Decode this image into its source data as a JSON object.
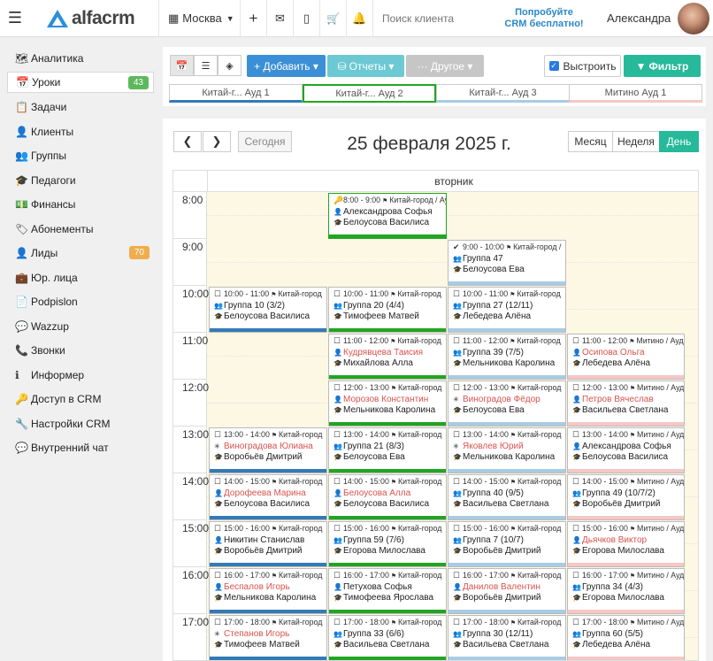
{
  "header": {
    "logo": "alfacrm",
    "city": "Москва",
    "search_placeholder": "Поиск клиента",
    "try_line1": "Попробуйте",
    "try_line2": "CRM бесплатно!",
    "user": "Александра"
  },
  "sidebar": [
    {
      "label": "Аналитика",
      "icon": "map-icon",
      "glyph": "🗺"
    },
    {
      "label": "Уроки",
      "icon": "calendar-icon",
      "glyph": "📅",
      "badge": "43",
      "badge_color": "#5cb85c",
      "active": true
    },
    {
      "label": "Задачи",
      "icon": "tasks-icon",
      "glyph": "📋"
    },
    {
      "label": "Клиенты",
      "icon": "user-icon",
      "glyph": "👤"
    },
    {
      "label": "Группы",
      "icon": "users-icon",
      "glyph": "👥"
    },
    {
      "label": "Педагоги",
      "icon": "graduation-cap-icon",
      "glyph": "🎓"
    },
    {
      "label": "Финансы",
      "icon": "money-icon",
      "glyph": "💵"
    },
    {
      "label": "Абонементы",
      "icon": "tag-icon",
      "glyph": "🏷"
    },
    {
      "label": "Лиды",
      "icon": "lead-icon",
      "glyph": "👤",
      "badge": "70",
      "badge_color": "#f0ad4e"
    },
    {
      "label": "Юр. лица",
      "icon": "briefcase-icon",
      "glyph": "💼"
    },
    {
      "label": "Podpislon",
      "icon": "document-icon",
      "glyph": "📄"
    },
    {
      "label": "Wazzup",
      "icon": "whatsapp-icon",
      "glyph": "💬"
    },
    {
      "label": "Звонки",
      "icon": "phone-icon",
      "glyph": "📞"
    },
    {
      "label": "Информер",
      "icon": "info-icon",
      "glyph": "ℹ"
    },
    {
      "label": "Доступ в CRM",
      "icon": "login-icon",
      "glyph": "🔑"
    },
    {
      "label": "Настройки CRM",
      "icon": "wrench-icon",
      "glyph": "🔧"
    },
    {
      "label": "Внутренний чат",
      "icon": "chat-icon",
      "glyph": "💬"
    }
  ],
  "toolbar": {
    "add_label": "+ Добавить ▾",
    "reports_label": "Отчеты ▾",
    "other_label": "··· Другое ▾",
    "hide_label": "Выстроить",
    "filter_label": "Фильтр"
  },
  "rooms": [
    {
      "label": "Китай-г... Ауд 1",
      "color": "#337ab7"
    },
    {
      "label": "Китай-г... Ауд 2",
      "color": "#22a522"
    },
    {
      "label": "Китай-г... Ауд 3",
      "color": "#a8cce4"
    },
    {
      "label": "Митино Ауд 1",
      "color": "#f7c6c6"
    }
  ],
  "calendar": {
    "today_label": "Сегодня",
    "date_title": "25 февраля 2025 г.",
    "month_label": "Месяц",
    "week_label": "Неделя",
    "day_label": "День",
    "weekday": "вторник",
    "hours": [
      "8:00",
      "9:00",
      "10:00",
      "11:00",
      "12:00",
      "13:00",
      "14:00",
      "15:00",
      "16:00",
      "17:00"
    ]
  },
  "events": [
    {
      "col": 1,
      "hour": 0,
      "icon": "🔑",
      "time": "8:00 - 9:00",
      "loc": "Китай-город / Ау",
      "who": "Александрова Софья",
      "who_icon": "👤",
      "teacher": "Белоусова Василиса",
      "highlight": true
    },
    {
      "col": 2,
      "hour": 1,
      "icon": "✔",
      "time": "9:00 - 10:00",
      "loc": "Китай-город /",
      "who": "Группа 47",
      "who_icon": "👥",
      "teacher": "Белоусова Ева"
    },
    {
      "col": 0,
      "hour": 2,
      "icon": "☐",
      "time": "10:00 - 11:00",
      "loc": "Китай-город",
      "who": "Группа 10 (3/2)",
      "who_icon": "👥",
      "teacher": "Белоусова Василиса"
    },
    {
      "col": 1,
      "hour": 2,
      "icon": "☐",
      "time": "10:00 - 11:00",
      "loc": "Китай-город",
      "who": "Группа 20 (4/4)",
      "who_icon": "👥",
      "teacher": "Тимофеев Матвей"
    },
    {
      "col": 2,
      "hour": 2,
      "icon": "☐",
      "time": "10:00 - 11:00",
      "loc": "Китай-город",
      "who": "Группа 27 (12/11)",
      "who_icon": "👥",
      "teacher": "Лебедева Алёна"
    },
    {
      "col": 1,
      "hour": 3,
      "icon": "☐",
      "time": "11:00 - 12:00",
      "loc": "Китай-город",
      "who": "Кудрявцева Таисия",
      "who_icon": "👤",
      "teacher": "Михайлова Алла",
      "red": true
    },
    {
      "col": 2,
      "hour": 3,
      "icon": "☐",
      "time": "11:00 - 12:00",
      "loc": "Китай-город",
      "who": "Группа 39 (7/5)",
      "who_icon": "👥",
      "teacher": "Мельникова Каролина"
    },
    {
      "col": 3,
      "hour": 3,
      "icon": "☐",
      "time": "11:00 - 12:00",
      "loc": "Митино / Ауд",
      "who": "Осипова Ольга",
      "who_icon": "👤",
      "teacher": "Лебедева Алёна",
      "red": true
    },
    {
      "col": 1,
      "hour": 4,
      "icon": "☐",
      "time": "12:00 - 13:00",
      "loc": "Китай-город",
      "who": "Морозов Константин",
      "who_icon": "👤",
      "teacher": "Мельникова Каролина",
      "red": true
    },
    {
      "col": 2,
      "hour": 4,
      "icon": "☐",
      "time": "12:00 - 13:00",
      "loc": "Китай-город",
      "who": "Виноградов Фёдор",
      "who_icon": "✳",
      "teacher": "Белоусова Ева",
      "red": true
    },
    {
      "col": 3,
      "hour": 4,
      "icon": "☐",
      "time": "12:00 - 13:00",
      "loc": "Митино / Ауд",
      "who": "Петров Вячеслав",
      "who_icon": "👤",
      "teacher": "Васильева Светлана",
      "red": true
    },
    {
      "col": 0,
      "hour": 5,
      "icon": "☐",
      "time": "13:00 - 14:00",
      "loc": "Китай-город",
      "who": "Виноградова Юлиана",
      "who_icon": "✳",
      "teacher": "Воробьёв Дмитрий",
      "red": true
    },
    {
      "col": 1,
      "hour": 5,
      "icon": "☐",
      "time": "13:00 - 14:00",
      "loc": "Китай-город",
      "who": "Группа 21 (8/3)",
      "who_icon": "👥",
      "teacher": "Белоусова Ева"
    },
    {
      "col": 2,
      "hour": 5,
      "icon": "☐",
      "time": "13:00 - 14:00",
      "loc": "Китай-город",
      "who": "Яковлев Юрий",
      "who_icon": "✳",
      "teacher": "Мельникова Каролина",
      "red": true
    },
    {
      "col": 3,
      "hour": 5,
      "icon": "☐",
      "time": "13:00 - 14:00",
      "loc": "Митино / Ауд",
      "who": "Александрова Софья",
      "who_icon": "👤",
      "teacher": "Белоусова Василиса"
    },
    {
      "col": 0,
      "hour": 6,
      "icon": "☐",
      "time": "14:00 - 15:00",
      "loc": "Китай-город",
      "who": "Дорофеева Марина",
      "who_icon": "👤",
      "teacher": "Белоусова Василиса",
      "red": true
    },
    {
      "col": 1,
      "hour": 6,
      "icon": "☐",
      "time": "14:00 - 15:00",
      "loc": "Китай-город",
      "who": "Белоусова Алла",
      "who_icon": "👤",
      "teacher": "Белоусова Василиса",
      "red": true
    },
    {
      "col": 2,
      "hour": 6,
      "icon": "☐",
      "time": "14:00 - 15:00",
      "loc": "Китай-город",
      "who": "Группа 40 (9/5)",
      "who_icon": "👥",
      "teacher": "Васильева Светлана"
    },
    {
      "col": 3,
      "hour": 6,
      "icon": "☐",
      "time": "14:00 - 15:00",
      "loc": "Митино / Ауд",
      "who": "Группа 49 (10/7/2)",
      "who_icon": "👥",
      "teacher": "Воробьёв Дмитрий"
    },
    {
      "col": 0,
      "hour": 7,
      "icon": "☐",
      "time": "15:00 - 16:00",
      "loc": "Китай-город",
      "who": "Никитин Станислав",
      "who_icon": "👤",
      "teacher": "Воробьёв Дмитрий"
    },
    {
      "col": 1,
      "hour": 7,
      "icon": "☐",
      "time": "15:00 - 16:00",
      "loc": "Китай-город",
      "who": "Группа 59 (7/6)",
      "who_icon": "👥",
      "teacher": "Егорова Милослава"
    },
    {
      "col": 2,
      "hour": 7,
      "icon": "☐",
      "time": "15:00 - 16:00",
      "loc": "Китай-город",
      "who": "Группа 7 (10/7)",
      "who_icon": "👥",
      "teacher": "Воробьёв Дмитрий"
    },
    {
      "col": 3,
      "hour": 7,
      "icon": "☐",
      "time": "15:00 - 16:00",
      "loc": "Митино / Ауд",
      "who": "Дьячков Виктор",
      "who_icon": "👤",
      "teacher": "Егорова Милослава",
      "red": true
    },
    {
      "col": 0,
      "hour": 8,
      "icon": "☐",
      "time": "16:00 - 17:00",
      "loc": "Китай-город",
      "who": "Беспалов Игорь",
      "who_icon": "👤",
      "teacher": "Мельникова Каролина",
      "red": true
    },
    {
      "col": 1,
      "hour": 8,
      "icon": "☐",
      "time": "16:00 - 17:00",
      "loc": "Китай-город",
      "who": "Петухова Софья",
      "who_icon": "👤",
      "teacher": "Тимофеева Ярослава"
    },
    {
      "col": 2,
      "hour": 8,
      "icon": "☐",
      "time": "16:00 - 17:00",
      "loc": "Китай-город",
      "who": "Данилов Валентин",
      "who_icon": "👤",
      "teacher": "Воробьёв Дмитрий",
      "red": true
    },
    {
      "col": 3,
      "hour": 8,
      "icon": "☐",
      "time": "16:00 - 17:00",
      "loc": "Митино / Ауд",
      "who": "Группа 34 (4/3)",
      "who_icon": "👥",
      "teacher": "Егорова Милослава"
    },
    {
      "col": 0,
      "hour": 9,
      "icon": "☐",
      "time": "17:00 - 18:00",
      "loc": "Китай-город",
      "who": "Степанов Игорь",
      "who_icon": "✳",
      "teacher": "Тимофеев Матвей",
      "red": true
    },
    {
      "col": 1,
      "hour": 9,
      "icon": "☐",
      "time": "17:00 - 18:00",
      "loc": "Китай-город",
      "who": "Группа 33 (6/6)",
      "who_icon": "👥",
      "teacher": "Васильева Светлана"
    },
    {
      "col": 2,
      "hour": 9,
      "icon": "☐",
      "time": "17:00 - 18:00",
      "loc": "Китай-город",
      "who": "Группа 30 (12/11)",
      "who_icon": "👥",
      "teacher": "Васильева Светлана"
    },
    {
      "col": 3,
      "hour": 9,
      "icon": "☐",
      "time": "17:00 - 18:00",
      "loc": "Митино / Ауд",
      "who": "Группа 60 (5/5)",
      "who_icon": "👥",
      "teacher": "Лебедева Алёна"
    }
  ]
}
